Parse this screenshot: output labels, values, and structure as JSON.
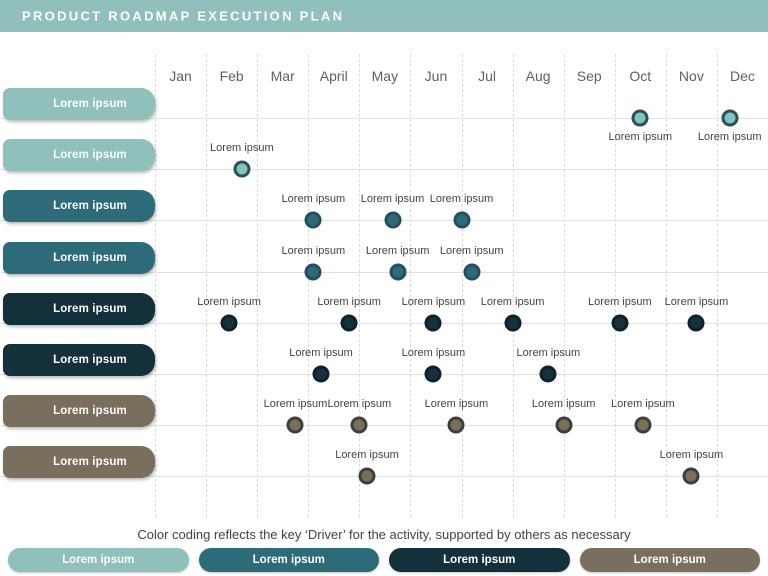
{
  "header": {
    "title": "PRODUCT ROADMAP EXECUTION PLAN",
    "bg_color": "#8fc0bc",
    "text_color": "#ffffff"
  },
  "timeline": {
    "months": [
      "Jan",
      "Feb",
      "Mar",
      "April",
      "May",
      "Jun",
      "Jul",
      "Aug",
      "Sep",
      "Oct",
      "Nov",
      "Dec"
    ]
  },
  "palette": {
    "light_teal": "#8fc0bc",
    "medium_teal": "#2d6b78",
    "dark_navy": "#14303a",
    "brown": "#7a6e5d",
    "marker_light_fill": "#7ec4c0",
    "marker_light_ring": "#2e4f57",
    "marker_medium_fill": "#2f6a7c",
    "marker_medium_ring": "#24505e",
    "marker_dark_fill": "#16303d",
    "marker_dark_ring": "#0e222c",
    "marker_brown_fill": "#7d6f55",
    "marker_brown_ring": "#3c3f46",
    "grid_line": "#dfe2e3",
    "grid_dash": "#d9dcdd"
  },
  "rows": [
    {
      "label": "Lorem ipsum",
      "color": "#8fc0bc",
      "marker_fill": "#7ec4c0",
      "marker_ring": "#2e4f57",
      "markers": [
        {
          "month": 10.0,
          "label": "Lorem ipsum",
          "label_pos": "below"
        },
        {
          "month": 11.75,
          "label": "Lorem ipsum",
          "label_pos": "below"
        }
      ]
    },
    {
      "label": "Lorem ipsum",
      "color": "#8fc0bc",
      "marker_fill": "#7ec4c0",
      "marker_ring": "#2e4f57",
      "markers": [
        {
          "month": 2.2,
          "label": "Lorem ipsum",
          "label_pos": "above"
        }
      ]
    },
    {
      "label": "Lorem ipsum",
      "color": "#2d6b78",
      "marker_fill": "#2f6a7c",
      "marker_ring": "#24505e",
      "markers": [
        {
          "month": 3.6,
          "label": "Lorem ipsum",
          "label_pos": "above"
        },
        {
          "month": 5.15,
          "label": "Lorem ipsum",
          "label_pos": "above"
        },
        {
          "month": 6.5,
          "label": "Lorem ipsum",
          "label_pos": "above"
        }
      ]
    },
    {
      "label": "Lorem ipsum",
      "color": "#2d6b78",
      "marker_fill": "#2f6a7c",
      "marker_ring": "#24505e",
      "markers": [
        {
          "month": 3.6,
          "label": "Lorem ipsum",
          "label_pos": "above"
        },
        {
          "month": 5.25,
          "label": "Lorem ipsum",
          "label_pos": "above"
        },
        {
          "month": 6.7,
          "label": "Lorem ipsum",
          "label_pos": "above"
        }
      ]
    },
    {
      "label": "Lorem ipsum",
      "color": "#14303a",
      "marker_fill": "#16303d",
      "marker_ring": "#0e222c",
      "markers": [
        {
          "month": 1.95,
          "label": "Lorem ipsum",
          "label_pos": "above"
        },
        {
          "month": 4.3,
          "label": "Lorem ipsum",
          "label_pos": "above"
        },
        {
          "month": 5.95,
          "label": "Lorem ipsum",
          "label_pos": "above"
        },
        {
          "month": 7.5,
          "label": "Lorem ipsum",
          "label_pos": "above"
        },
        {
          "month": 9.6,
          "label": "Lorem ipsum",
          "label_pos": "above"
        },
        {
          "month": 11.1,
          "label": "Lorem ipsum",
          "label_pos": "above"
        }
      ]
    },
    {
      "label": "Lorem ipsum",
      "color": "#14303a",
      "marker_fill": "#16303d",
      "marker_ring": "#0e222c",
      "markers": [
        {
          "month": 3.75,
          "label": "Lorem ipsum",
          "label_pos": "above"
        },
        {
          "month": 5.95,
          "label": "Lorem ipsum",
          "label_pos": "above"
        },
        {
          "month": 8.2,
          "label": "Lorem ipsum",
          "label_pos": "above"
        }
      ]
    },
    {
      "label": "Lorem ipsum",
      "color": "#7a6e5d",
      "marker_fill": "#7d6f55",
      "marker_ring": "#3c3f46",
      "markers": [
        {
          "month": 3.25,
          "label": "Lorem ipsum",
          "label_pos": "above"
        },
        {
          "month": 4.5,
          "label": "Lorem ipsum",
          "label_pos": "above"
        },
        {
          "month": 6.4,
          "label": "Lorem ipsum",
          "label_pos": "above"
        },
        {
          "month": 8.5,
          "label": "Lorem ipsum",
          "label_pos": "above"
        },
        {
          "month": 10.05,
          "label": "Lorem ipsum",
          "label_pos": "above"
        }
      ]
    },
    {
      "label": "Lorem ipsum",
      "color": "#7a6e5d",
      "marker_fill": "#7d6f55",
      "marker_ring": "#3c3f46",
      "markers": [
        {
          "month": 4.65,
          "label": "Lorem ipsum",
          "label_pos": "above"
        },
        {
          "month": 11.0,
          "label": "Lorem ipsum",
          "label_pos": "above"
        }
      ]
    }
  ],
  "footer": {
    "note": "Color coding reflects the key ‘Driver’ for the activity, supported by others as necessary",
    "legend": [
      {
        "label": "Lorem ipsum",
        "color": "#8fc0bc"
      },
      {
        "label": "Lorem ipsum",
        "color": "#2d6b78"
      },
      {
        "label": "Lorem ipsum",
        "color": "#14303a"
      },
      {
        "label": "Lorem ipsum",
        "color": "#7a6e5d"
      }
    ]
  }
}
